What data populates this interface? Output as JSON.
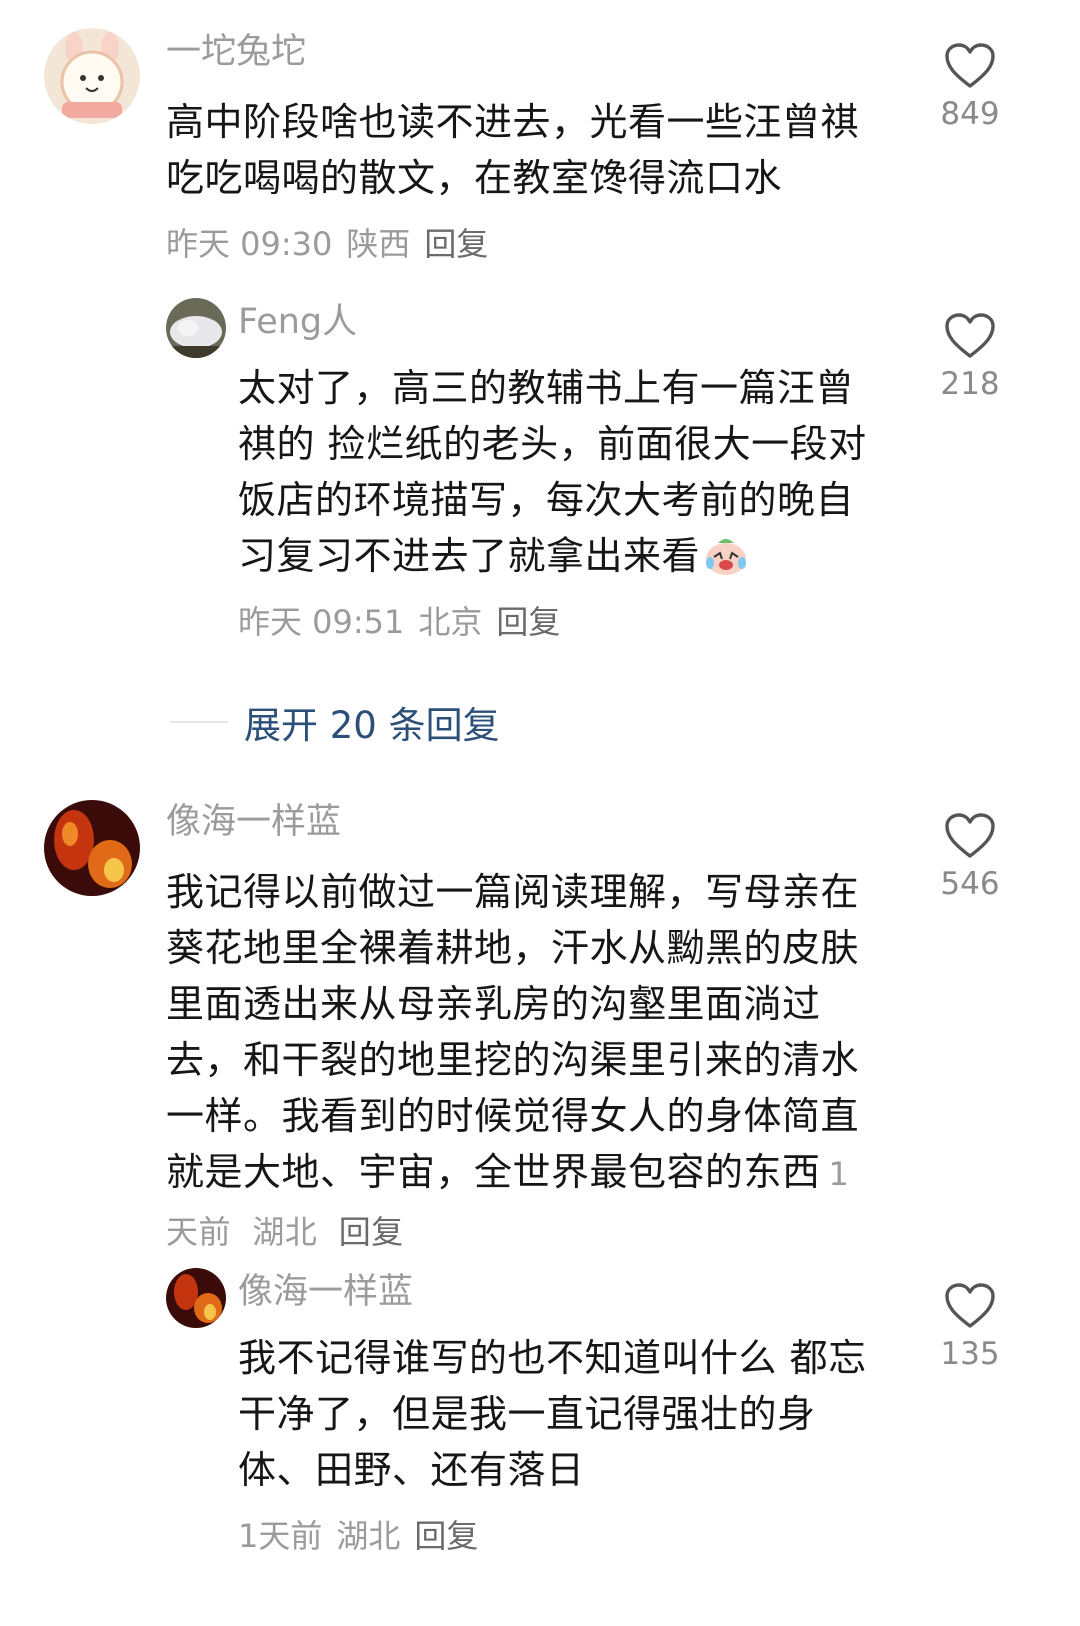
{
  "comments": [
    {
      "username": "一坨兔坨",
      "text": "高中阶段啥也读不进去，光看一些汪曾祺吃吃喝喝的散文，在教室馋得流口水",
      "time": "昨天 09:30",
      "location": "陕西",
      "reply_label": "回复",
      "likes": "849"
    },
    {
      "username": "Feng人",
      "text": "太对了，高三的教辅书上有一篇汪曾祺的 捡烂纸的老头，前面很大一段对饭店的环境描写，每次大考前的晚自习复习不进去了就拿出来看",
      "time": "昨天 09:51",
      "location": "北京",
      "reply_label": "回复",
      "likes": "218"
    },
    {
      "username": "像海一样蓝",
      "text": "我记得以前做过一篇阅读理解，写母亲在葵花地里全裸着耕地，汗水从黝黑的皮肤里面透出来从母亲乳房的沟壑里面淌过去，和干裂的地里挖的沟渠里引来的清水一样。我看到的时候觉得女人的身体简直就是大地、宇宙，全世界最包容的东西",
      "time": "1天前",
      "location": "湖北",
      "reply_label": "回复",
      "likes": "546"
    },
    {
      "username": "像海一样蓝",
      "text": "我不记得谁写的也不知道叫什么 都忘干净了，但是我一直记得强壮的身体、田野、还有落日",
      "time": "1天前",
      "location": "湖北",
      "reply_label": "回复",
      "likes": "135"
    }
  ],
  "expand_replies": "展开 20 条回复",
  "icons": {
    "like": "heart-outline-icon",
    "emoji": "crying-laughing-emoji"
  },
  "colors": {
    "username": "#9b9b9b",
    "text": "#161616",
    "link": "#2b4f78",
    "heart_stroke": "#555555"
  }
}
